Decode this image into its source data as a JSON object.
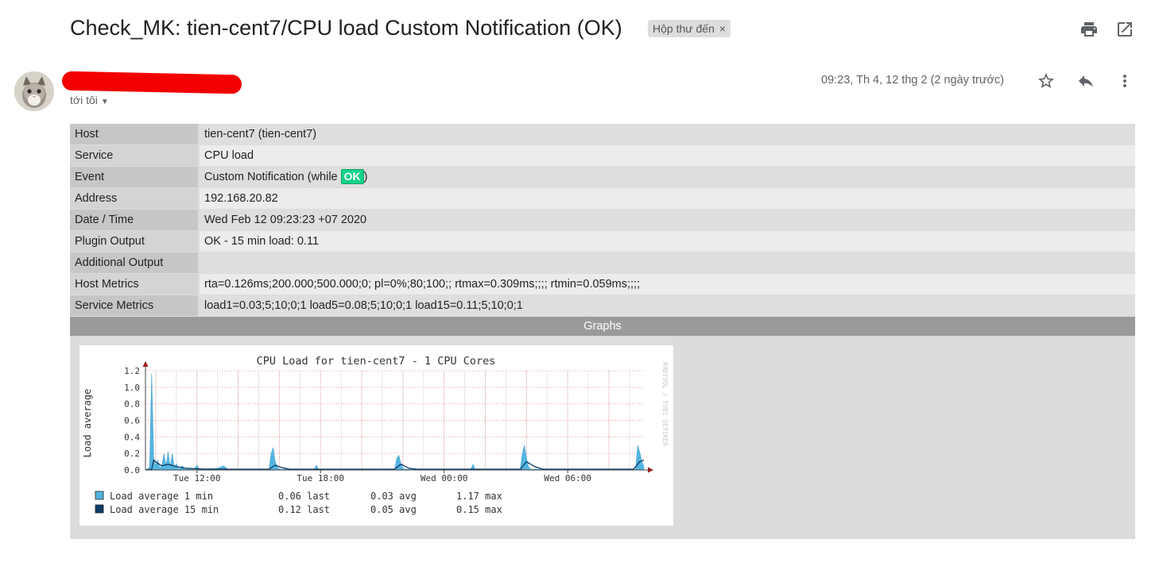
{
  "email": {
    "subject": "Check_MK: tien-cent7/CPU load Custom Notification (OK)",
    "label": "Hộp thư đến",
    "label_close": "×",
    "recipient": "tới tôi",
    "date": "09:23, Th 4, 12 thg 2 (2 ngày trước)"
  },
  "icons": {
    "print": "printer-icon",
    "new_window": "open-in-new-icon",
    "star": "star-icon",
    "reply": "reply-icon",
    "more": "more-vert-icon"
  },
  "table": {
    "rows": [
      {
        "key": "Host",
        "value": "tien-cent7 (tien-cent7)"
      },
      {
        "key": "Service",
        "value": "CPU load"
      },
      {
        "key": "Event",
        "value_prefix": "Custom Notification (while ",
        "badge": "OK",
        "value_suffix": ")"
      },
      {
        "key": "Address",
        "value": "192.168.20.82"
      },
      {
        "key": "Date / Time",
        "value": "Wed Feb 12 09:23:23 +07 2020"
      },
      {
        "key": "Plugin Output",
        "value": "OK - 15 min load: 0.11"
      },
      {
        "key": "Additional Output",
        "value": ""
      },
      {
        "key": "Host Metrics",
        "value": "rta=0.126ms;200.000;500.000;0; pl=0%;80;100;; rtmax=0.309ms;;;; rtmin=0.059ms;;;;"
      },
      {
        "key": "Service Metrics",
        "value": "load1=0.03;5;10;0;1 load5=0.08;5;10;0;1 load15=0.11;5;10;0;1"
      }
    ],
    "graphs_header": "Graphs"
  },
  "colors": {
    "ok_badge": "#13d389",
    "series_1min": "#54b5e0",
    "series_15min": "#0b3a66",
    "grid": "#f4a0a0",
    "axis_arrow": "#9b1b1b"
  },
  "chart_data": {
    "type": "area",
    "title": "CPU Load for tien-cent7 - 1 CPU Cores",
    "ylabel": "Load average",
    "watermark": "RRDTOOL / TOBI OETIKER",
    "ylim": [
      0,
      1.2
    ],
    "yticks": [
      "0.0",
      "0.2",
      "0.4",
      "0.6",
      "0.8",
      "1.0",
      "1.2"
    ],
    "xlim": [
      9.5,
      33.7
    ],
    "xticks": [
      {
        "x": 12,
        "label": "Tue 12:00"
      },
      {
        "x": 18,
        "label": "Tue 18:00"
      },
      {
        "x": 24,
        "label": "Wed 00:00"
      },
      {
        "x": 30,
        "label": "Wed 06:00"
      }
    ],
    "series": [
      {
        "name": "Load average  1 min",
        "kind": "area",
        "points": [
          [
            9.5,
            0
          ],
          [
            9.7,
            0.03
          ],
          [
            9.8,
            1.17
          ],
          [
            9.9,
            0.15
          ],
          [
            10.0,
            0.05
          ],
          [
            10.1,
            0.12
          ],
          [
            10.2,
            0.02
          ],
          [
            10.3,
            0.06
          ],
          [
            10.4,
            0.2
          ],
          [
            10.5,
            0.05
          ],
          [
            10.6,
            0.22
          ],
          [
            10.7,
            0.04
          ],
          [
            10.8,
            0.2
          ],
          [
            10.9,
            0.03
          ],
          [
            11.0,
            0.08
          ],
          [
            11.1,
            0.01
          ],
          [
            11.3,
            0.05
          ],
          [
            11.4,
            0.01
          ],
          [
            11.9,
            0.02
          ],
          [
            12.0,
            0.06
          ],
          [
            12.1,
            0.01
          ],
          [
            13.0,
            0.02
          ],
          [
            13.3,
            0.05
          ],
          [
            13.5,
            0.01
          ],
          [
            15.5,
            0.01
          ],
          [
            15.6,
            0.2
          ],
          [
            15.7,
            0.27
          ],
          [
            15.8,
            0.1
          ],
          [
            15.9,
            0.04
          ],
          [
            16.0,
            0.01
          ],
          [
            17.7,
            0.01
          ],
          [
            17.8,
            0.06
          ],
          [
            17.9,
            0.01
          ],
          [
            21.6,
            0.01
          ],
          [
            21.7,
            0.14
          ],
          [
            21.8,
            0.18
          ],
          [
            21.9,
            0.08
          ],
          [
            22.0,
            0.02
          ],
          [
            22.1,
            0.01
          ],
          [
            25.3,
            0.01
          ],
          [
            25.4,
            0.07
          ],
          [
            25.5,
            0.01
          ],
          [
            27.7,
            0.01
          ],
          [
            27.8,
            0.2
          ],
          [
            27.9,
            0.3
          ],
          [
            28.0,
            0.15
          ],
          [
            28.1,
            0.04
          ],
          [
            28.2,
            0.01
          ],
          [
            33.3,
            0.01
          ],
          [
            33.4,
            0.3
          ],
          [
            33.5,
            0.22
          ],
          [
            33.6,
            0.1
          ],
          [
            33.7,
            0.05
          ]
        ]
      },
      {
        "name": "Load average 15 min",
        "kind": "line",
        "points": [
          [
            9.5,
            0.0
          ],
          [
            9.8,
            0.01
          ],
          [
            9.9,
            0.12
          ],
          [
            10.1,
            0.08
          ],
          [
            10.3,
            0.05
          ],
          [
            10.6,
            0.07
          ],
          [
            11.0,
            0.04
          ],
          [
            11.5,
            0.02
          ],
          [
            12.5,
            0.01
          ],
          [
            15.5,
            0.01
          ],
          [
            15.8,
            0.06
          ],
          [
            16.1,
            0.03
          ],
          [
            16.5,
            0.01
          ],
          [
            21.6,
            0.01
          ],
          [
            21.9,
            0.07
          ],
          [
            22.3,
            0.02
          ],
          [
            22.7,
            0.01
          ],
          [
            27.7,
            0.01
          ],
          [
            28.0,
            0.1
          ],
          [
            28.4,
            0.04
          ],
          [
            28.8,
            0.01
          ],
          [
            33.2,
            0.01
          ],
          [
            33.5,
            0.1
          ],
          [
            33.7,
            0.12
          ]
        ]
      }
    ],
    "legend": [
      {
        "name": "Load average  1 min",
        "last": "0.06 last",
        "avg": "0.03 avg",
        "max": "1.17 max"
      },
      {
        "name": "Load average 15 min",
        "last": "0.12 last",
        "avg": "0.05 avg",
        "max": "0.15 max"
      }
    ]
  }
}
